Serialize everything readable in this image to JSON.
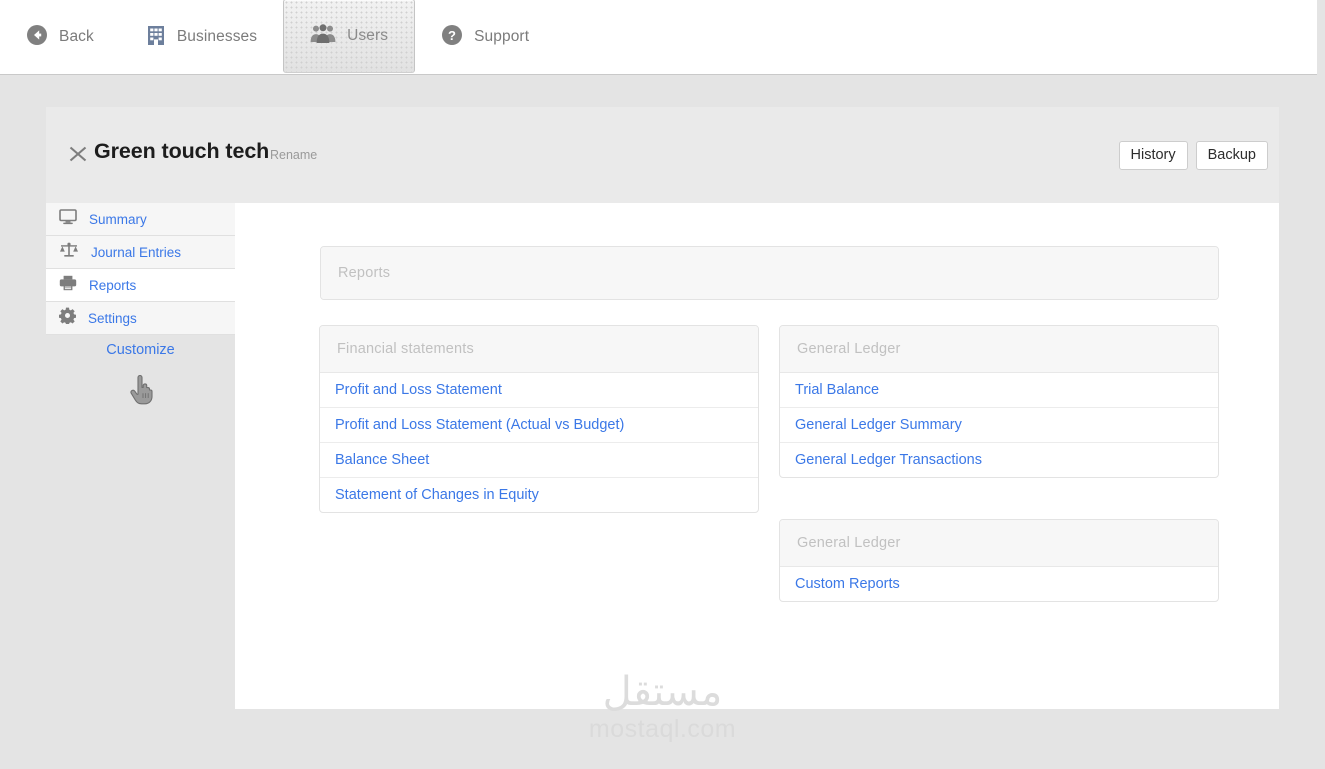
{
  "topbar": {
    "tabs": [
      {
        "id": "back",
        "label": "Back",
        "icon": "back-arrow-circle-icon",
        "selected": false
      },
      {
        "id": "businesses",
        "label": "Businesses",
        "icon": "building-icon",
        "selected": false
      },
      {
        "id": "users",
        "label": "Users",
        "icon": "users-group-icon",
        "selected": true
      },
      {
        "id": "support",
        "label": "Support",
        "icon": "question-circle-icon",
        "selected": false
      }
    ]
  },
  "panel": {
    "close_icon": "close-x-icon",
    "business_name": "Green touch tech",
    "rename_label": "Rename",
    "buttons": [
      {
        "id": "history",
        "label": "History"
      },
      {
        "id": "backup",
        "label": "Backup"
      }
    ]
  },
  "sidebar": {
    "items": [
      {
        "id": "summary",
        "label": "Summary",
        "icon": "monitor-icon",
        "active": false
      },
      {
        "id": "journal-entries",
        "label": "Journal Entries",
        "icon": "scales-icon",
        "active": false
      },
      {
        "id": "reports",
        "label": "Reports",
        "icon": "printer-icon",
        "active": true
      },
      {
        "id": "settings",
        "label": "Settings",
        "icon": "gear-icon",
        "active": false
      }
    ],
    "customize_label": "Customize",
    "cursor_icon": "pointing-hand-cursor-icon"
  },
  "content": {
    "page_card_title": "Reports",
    "left_column": [
      {
        "id": "financial-statements",
        "title": "Financial statements",
        "rows": [
          "Profit and Loss Statement",
          "Profit and Loss Statement (Actual vs Budget)",
          "Balance Sheet",
          "Statement of Changes in Equity"
        ]
      }
    ],
    "right_column": [
      {
        "id": "general-ledger",
        "title": "General Ledger",
        "rows": [
          "Trial Balance",
          "General Ledger Summary",
          "General Ledger Transactions"
        ]
      },
      {
        "id": "general-ledger-custom",
        "title": "General Ledger",
        "rows": [
          "Custom Reports"
        ]
      }
    ]
  },
  "watermark": {
    "arabic": "مستقل",
    "latin": "mostaql.com"
  },
  "colors": {
    "link": "#3b78e7",
    "page_background": "#e4e4e4",
    "panel_background": "#eaeaea",
    "card_header_text": "#c1c1c1",
    "muted_text": "#7b7b7b"
  }
}
